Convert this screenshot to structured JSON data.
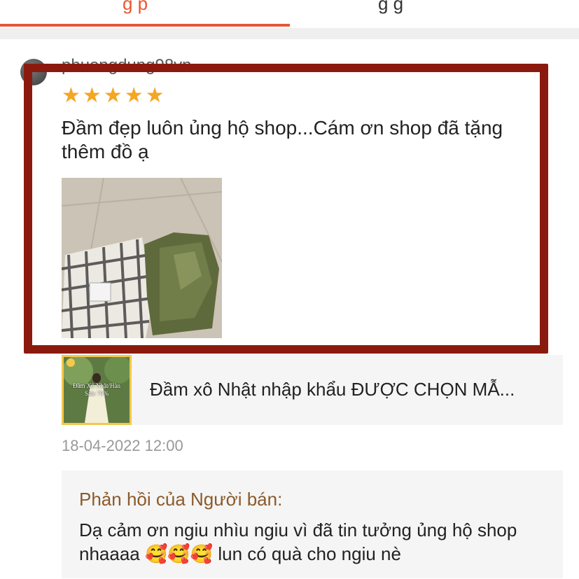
{
  "tabs": [
    {
      "label": "g   p",
      "active": true
    },
    {
      "label": "g  g",
      "active": false
    }
  ],
  "review": {
    "username": "phuongdung98vn",
    "rating": 5,
    "text": "Đầm đẹp luôn ủng hộ shop...Cám ơn shop đã tặng thêm đồ ạ",
    "date": "18-04-2022 12:00"
  },
  "product": {
    "name": "Đầm xô Nhật nhập khẩu ĐƯỢC CHỌN MẪ...",
    "thumb_caption_1": "Đầm Xô Nhật/Hàn",
    "thumb_caption_2": "Sale 79%"
  },
  "seller_reply": {
    "title": "Phản hồi của Người bán:",
    "text": "Dạ cảm ơn ngiu nhìu ngiu vì đã tin tưởng ủng hộ shop nhaaaa 🥰🥰🥰 lun có quà cho ngiu nè"
  },
  "colors": {
    "accent": "#e05a3a",
    "highlight_box": "#8b1a0e",
    "star": "#f5a623",
    "reply_title": "#8b5a2b"
  },
  "icons": {
    "star": "star-icon",
    "avatar": "avatar"
  }
}
